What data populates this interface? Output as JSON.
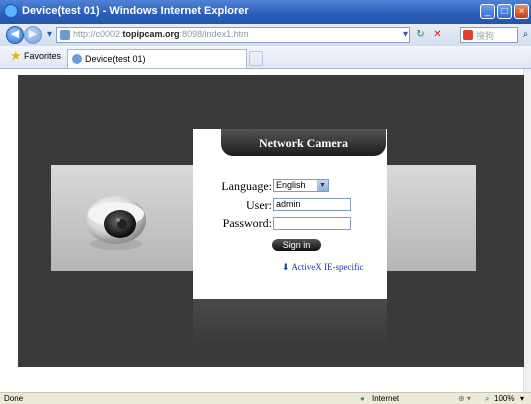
{
  "window": {
    "title": "Device(test 01) - Windows Internet Explorer",
    "icon": "ie-icon",
    "controls": [
      "minimize",
      "maximize",
      "close"
    ]
  },
  "addressbar": {
    "url_prefix": "http://c0002.",
    "url_domain": "topipcam.org",
    "url_suffix": ":8098/index1.htm",
    "search_placeholder": "搜狗"
  },
  "favorites": {
    "label": "Favorites",
    "tab_label": "Device(test 01)"
  },
  "login": {
    "header": "Network Camera",
    "language_label": "Language:",
    "language_value": "English",
    "user_label": "User:",
    "user_value": "admin",
    "password_label": "Password:",
    "password_value": "",
    "signin_label": "Sign in",
    "activex_label": "ActiveX IE-specific"
  },
  "statusbar": {
    "left": "Done",
    "zone": "Internet",
    "zoom": "100%"
  }
}
